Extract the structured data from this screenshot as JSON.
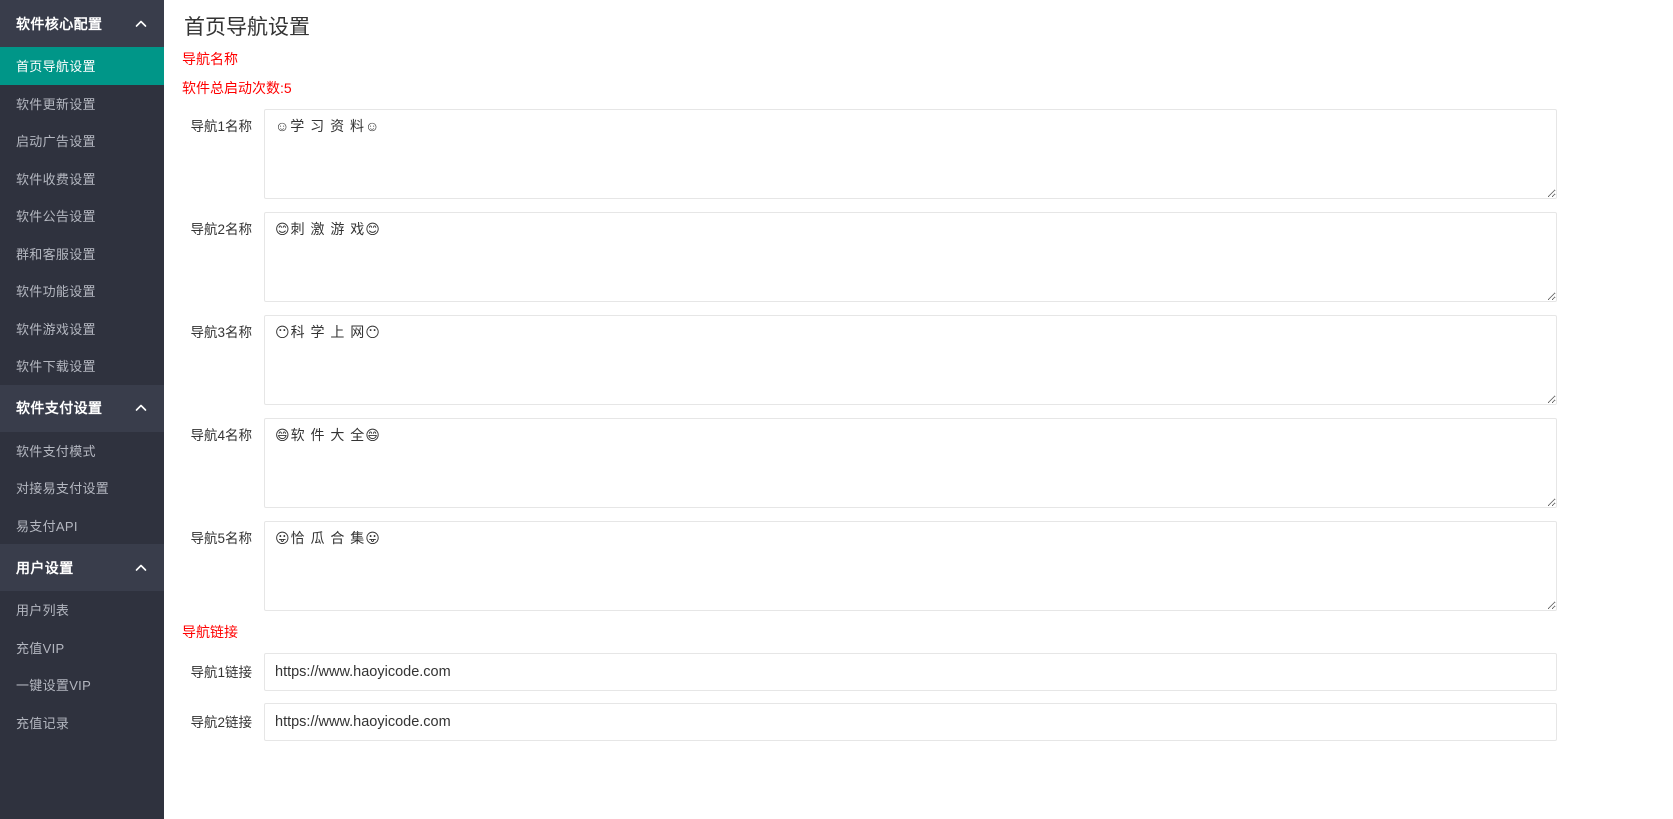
{
  "sidebar": {
    "groups": [
      {
        "title": "软件核心配置",
        "icon": "chevron-up-icon",
        "items": [
          {
            "label": "首页导航设置",
            "active": true
          },
          {
            "label": "软件更新设置",
            "active": false
          },
          {
            "label": "启动广告设置",
            "active": false
          },
          {
            "label": "软件收费设置",
            "active": false
          },
          {
            "label": "软件公告设置",
            "active": false
          },
          {
            "label": "群和客服设置",
            "active": false
          },
          {
            "label": "软件功能设置",
            "active": false
          },
          {
            "label": "软件游戏设置",
            "active": false
          },
          {
            "label": "软件下载设置",
            "active": false
          }
        ]
      },
      {
        "title": "软件支付设置",
        "icon": "chevron-up-icon",
        "items": [
          {
            "label": "软件支付模式",
            "active": false
          },
          {
            "label": "对接易支付设置",
            "active": false
          },
          {
            "label": "易支付API",
            "active": false
          }
        ]
      },
      {
        "title": "用户设置",
        "icon": "chevron-up-icon",
        "items": [
          {
            "label": "用户列表",
            "active": false
          },
          {
            "label": "充值VIP",
            "active": false
          },
          {
            "label": "一键设置VIP",
            "active": false
          },
          {
            "label": "充值记录",
            "active": false
          }
        ]
      }
    ]
  },
  "page": {
    "title": "首页导航设置",
    "name_section_label": "导航名称",
    "launch_count_label": "软件总启动次数:5",
    "link_section_label": "导航链接",
    "accent_red": "#ff0000",
    "accent_teal": "#009688"
  },
  "nav_names": [
    {
      "label": "导航1名称",
      "value": "☺学 习 资 料☺"
    },
    {
      "label": "导航2名称",
      "value": "😊刺 激 游 戏😊"
    },
    {
      "label": "导航3名称",
      "value": "😶科 学 上 网😶"
    },
    {
      "label": "导航4名称",
      "value": "😄软 件 大 全😄"
    },
    {
      "label": "导航5名称",
      "value": "😛恰 瓜 合 集😛"
    }
  ],
  "nav_links": [
    {
      "label": "导航1链接",
      "value": "https://www.haoyicode.com"
    },
    {
      "label": "导航2链接",
      "value": "https://www.haoyicode.com"
    }
  ]
}
